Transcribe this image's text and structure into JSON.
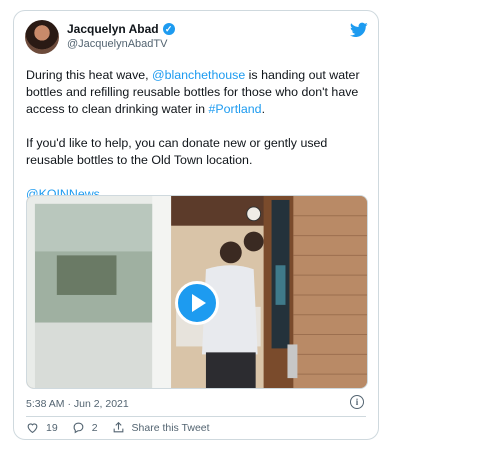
{
  "tweet": {
    "display_name": "Jacquelyn Abad",
    "handle": "@JacquelynAbadTV",
    "text_part1": "During this heat wave, ",
    "mention_org": "@blanchethouse",
    "text_part2": " is handing out water bottles and refilling reusable bottles for those who don't have access to clean drinking water in ",
    "hashtag": "#Portland",
    "text_part3": ".",
    "text_para2": "If you'd like to help, you can donate new or gently used reusable bottles to the Old Town location.",
    "mention_station": "@KOINNews",
    "timestamp": "5:38 AM · Jun 2, 2021"
  },
  "actions": {
    "likes": "19",
    "replies": "2",
    "share_label": "Share this Tweet"
  },
  "icons": {
    "verified": "verified-badge-icon",
    "bird": "twitter-bird-icon",
    "play": "play-icon",
    "info": "info-icon",
    "heart": "heart-icon",
    "reply": "reply-icon",
    "share": "share-icon"
  },
  "colors": {
    "accent": "#1d9bf0",
    "text": "#0f1419",
    "muted": "#536471",
    "border": "#cfd9de"
  }
}
